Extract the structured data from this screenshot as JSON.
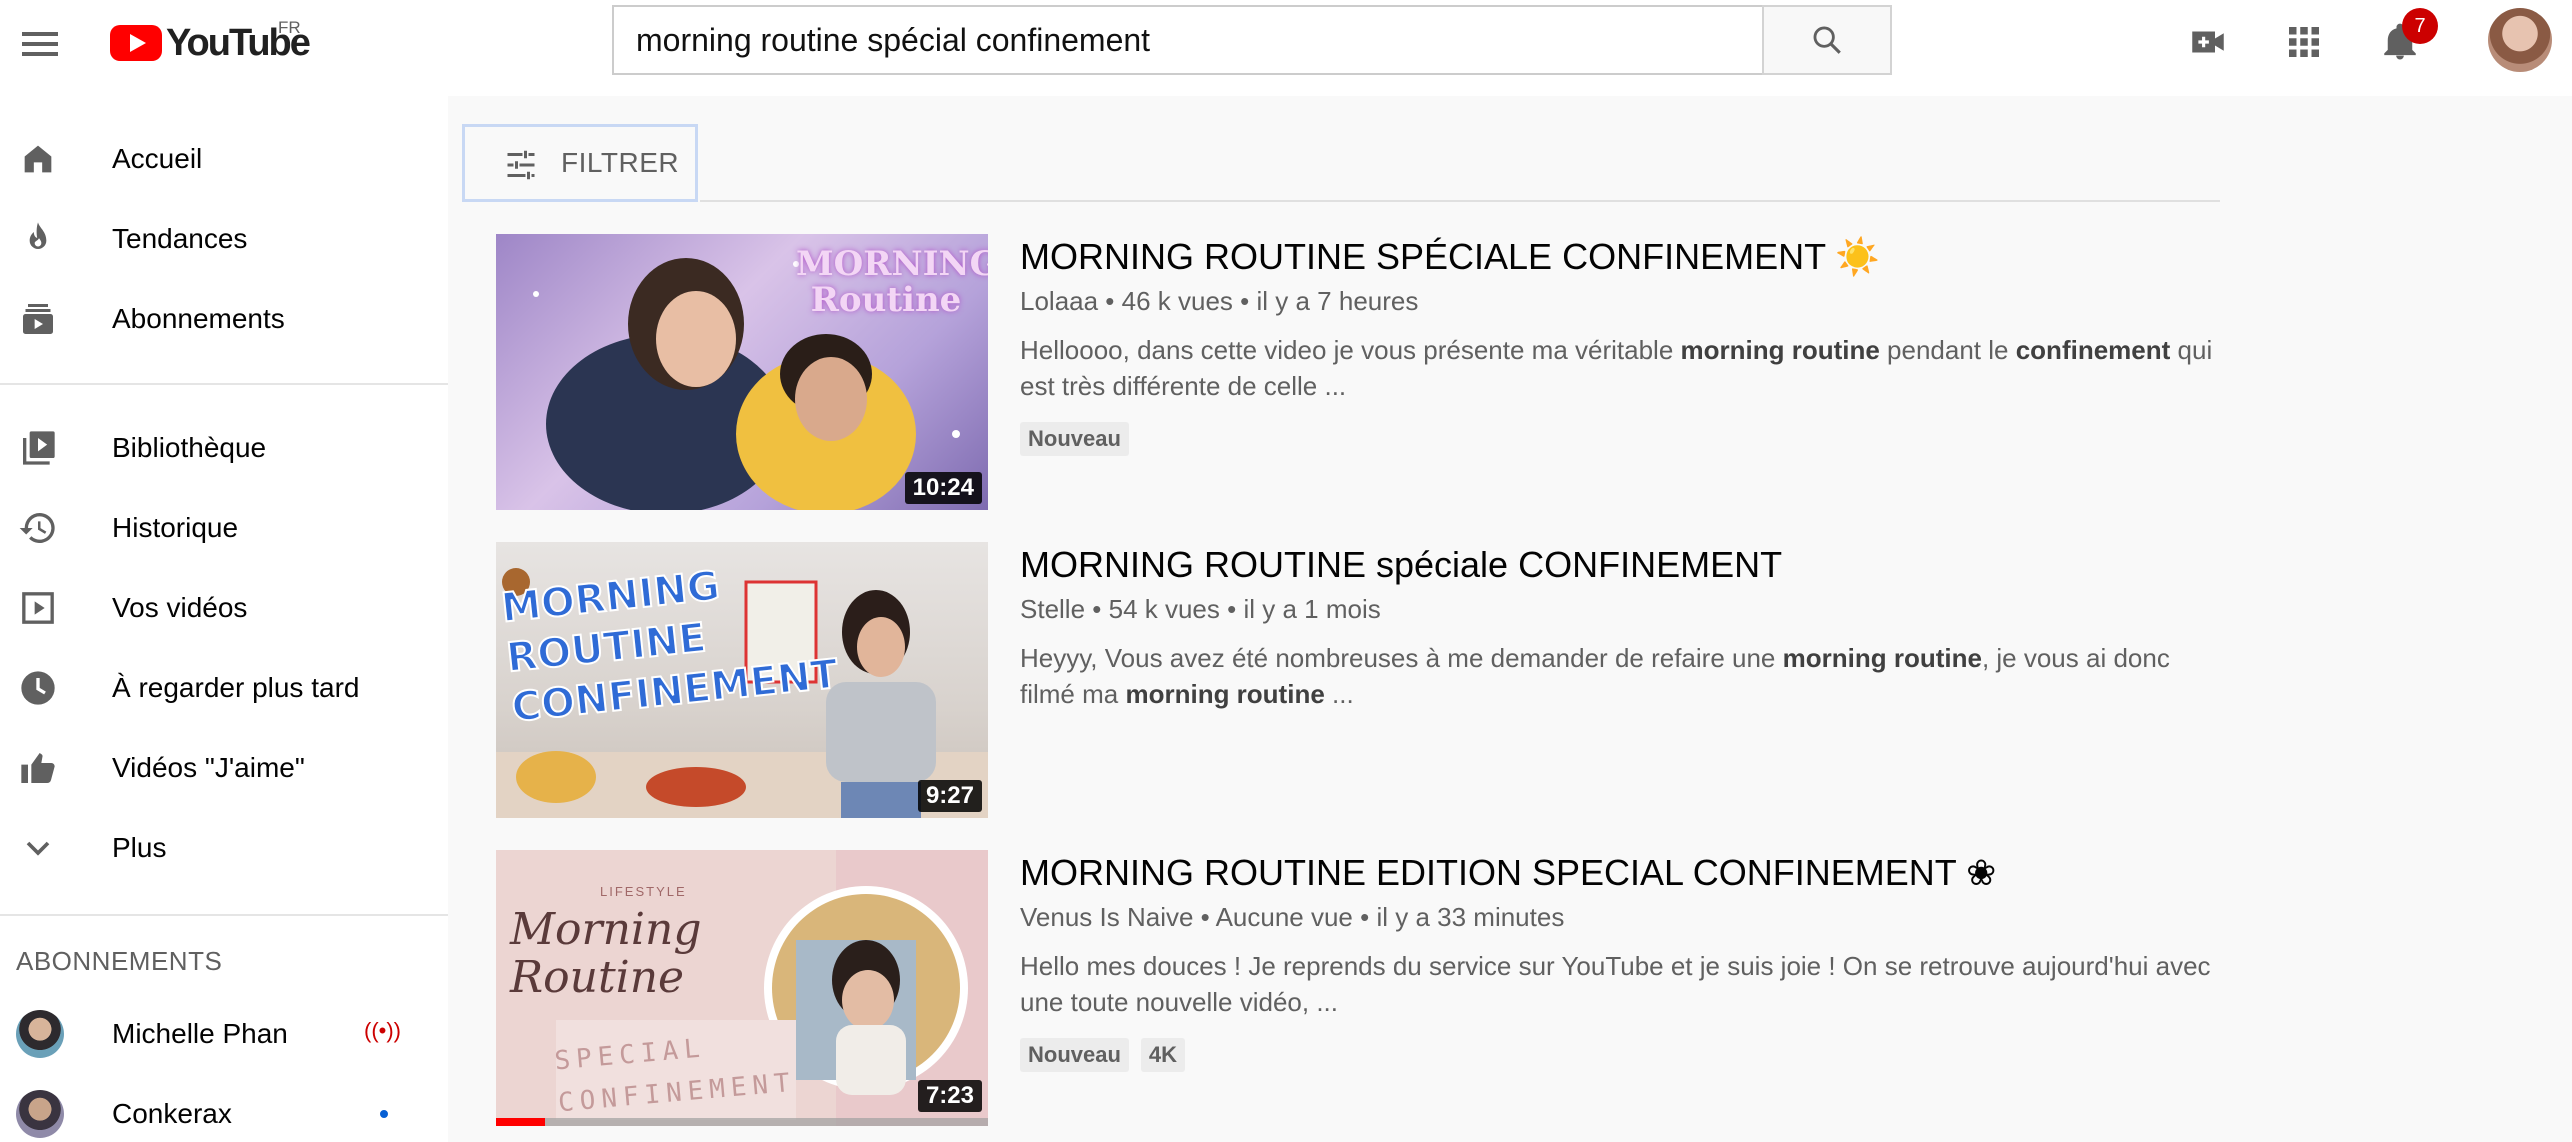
{
  "header": {
    "logo_text": "YouTube",
    "country": "FR",
    "search_value": "morning routine spécial confinement",
    "notification_count": "7"
  },
  "sidebar": {
    "main_items": [
      {
        "label": "Accueil",
        "icon": "home-icon"
      },
      {
        "label": "Tendances",
        "icon": "fire-icon"
      },
      {
        "label": "Abonnements",
        "icon": "subscriptions-icon"
      }
    ],
    "library_items": [
      {
        "label": "Bibliothèque",
        "icon": "library-icon"
      },
      {
        "label": "Historique",
        "icon": "history-icon"
      },
      {
        "label": "Vos vidéos",
        "icon": "your-videos-icon"
      },
      {
        "label": "À regarder plus tard",
        "icon": "watch-later-icon"
      },
      {
        "label": "Vidéos \"J'aime\"",
        "icon": "thumb-up-icon"
      },
      {
        "label": "Plus",
        "icon": "chevron-down-icon"
      }
    ],
    "subscriptions_title": "ABONNEMENTS",
    "subscriptions": [
      {
        "name": "Michelle Phan",
        "status": "live"
      },
      {
        "name": "Conkerax",
        "status": "new"
      }
    ]
  },
  "filter": {
    "label": "FILTRER"
  },
  "videos": [
    {
      "title": "MORNING ROUTINE SPÉCIALE CONFINEMENT ☀️",
      "channel": "Lolaaa",
      "views": "46 k vues",
      "age": "il y a 7 heures",
      "desc_parts": [
        "Helloooo, dans cette video je vous présente ma véritable ",
        "morning routine",
        " pendant le ",
        "confinement",
        " qui est très différente de celle ..."
      ],
      "duration": "10:24",
      "tags": [
        "Nouveau"
      ],
      "thumb_text": "MORNING Routine"
    },
    {
      "title": "MORNING ROUTINE spéciale CONFINEMENT",
      "channel": "Stelle",
      "views": "54 k vues",
      "age": "il y a 1 mois",
      "desc_parts": [
        "Heyyy, Vous avez été nombreuses à me demander de refaire une ",
        "morning routine",
        ", je vous ai donc filmé ma ",
        "morning routine",
        " ..."
      ],
      "duration": "9:27",
      "tags": [],
      "thumb_text": "MORNING ROUTINE CONFINEMENT"
    },
    {
      "title": "MORNING ROUTINE EDITION SPECIAL CONFINEMENT ❀",
      "channel": "Venus Is Naive",
      "views": "Aucune vue",
      "age": "il y a 33 minutes",
      "desc_parts": [
        "Hello mes douces ! Je reprends du service sur YouTube et je suis joie ! On se retrouve aujourd'hui avec une toute nouvelle vidéo, ...",
        "",
        "",
        "",
        ""
      ],
      "duration": "7:23",
      "tags": [
        "Nouveau",
        "4K"
      ],
      "thumb_text": "Morning Routine",
      "thumb_subtext": "SPECIAL CONFINEMENT",
      "thumb_small": "LIFESTYLE",
      "watch_progress": 0.1
    }
  ]
}
